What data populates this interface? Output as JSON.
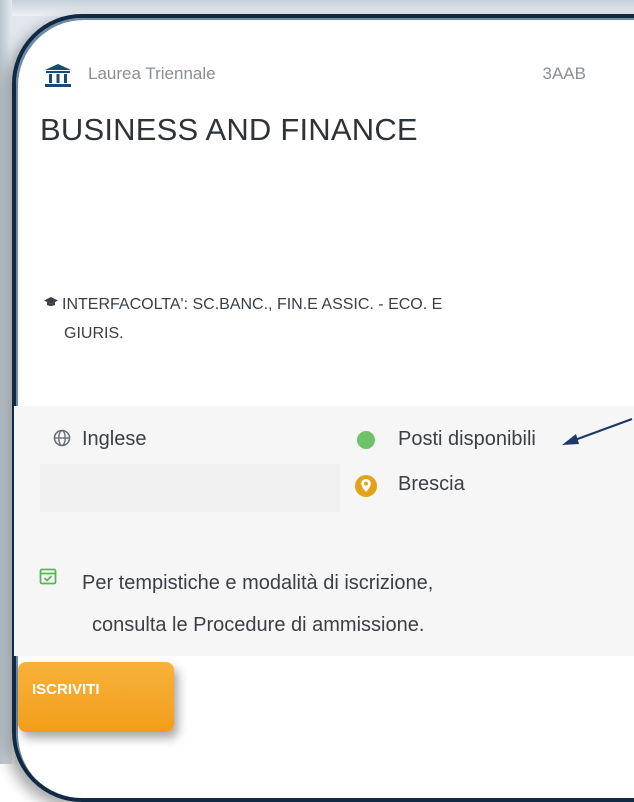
{
  "card": {
    "degree_type": "Laurea Triennale",
    "course_code": "3AAB",
    "title": "BUSINESS AND FINANCE",
    "faculty_line1": "INTERFACOLTA': SC.BANC., FIN.E ASSIC. - ECO. E",
    "faculty_line2": "GIURIS.",
    "language": "Inglese",
    "availability": "Posti disponibili",
    "location": "Brescia",
    "admission_line1": "Per tempistiche e modalità di iscrizione,",
    "admission_line2": "consulta le Procedure di ammissione.",
    "enroll_label": "ISCRIVITI"
  },
  "icons": {
    "degree": "institution-icon",
    "faculty": "graduation-cap-icon",
    "language": "globe-icon",
    "availability": "status-dot-icon",
    "location": "map-pin-icon",
    "admission": "calendar-check-icon",
    "annotation": "arrow-icon"
  },
  "colors": {
    "frame": "#0f2a45",
    "availability_dot": "#6fc36b",
    "location_pin": "#e3a21a",
    "calendar": "#5bb35a",
    "button": "#f29e1a",
    "text": "#3b4046",
    "muted_text": "#8a8f94"
  }
}
